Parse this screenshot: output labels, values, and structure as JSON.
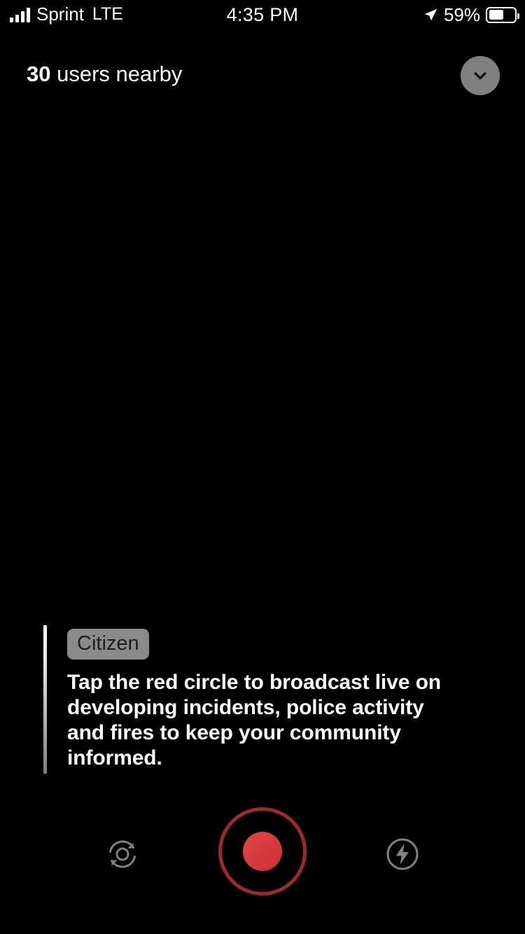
{
  "status_bar": {
    "carrier": "Sprint",
    "network_type": "LTE",
    "time": "4:35 PM",
    "battery_percent_label": "59%",
    "battery_level": 59,
    "signal_bars": 4,
    "icons": {
      "signal": "signal-bars-icon",
      "location": "location-arrow-icon",
      "battery": "battery-icon"
    }
  },
  "header": {
    "nearby_count": "30",
    "nearby_label": "users nearby",
    "collapse_icon": "chevron-down-icon"
  },
  "tip": {
    "badge": "Citizen",
    "body": "Tap the red circle to broadcast live on developing incidents, police activity and fires to keep your community informed."
  },
  "controls": {
    "flip_camera_icon": "camera-flip-icon",
    "record_icon": "record-button-icon",
    "flash_icon": "flash-icon"
  },
  "colors": {
    "background": "#000000",
    "accent_red_ring": "#9e2b2b",
    "accent_red_dot": "#d6393c",
    "icon_gray": "#808080",
    "badge_gray": "#8a8a8a",
    "text_white": "#ffffff"
  }
}
